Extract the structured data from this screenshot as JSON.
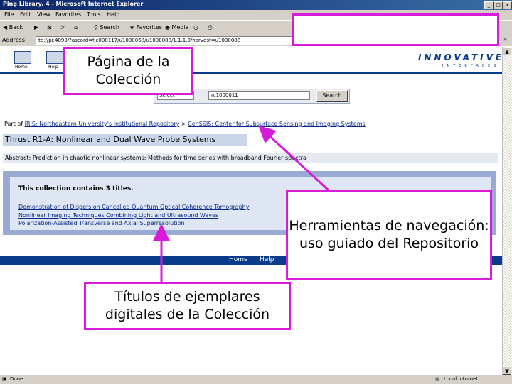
{
  "window": {
    "title": "Ping Library, 4 - Microsoft Internet Explorer",
    "controls": [
      "_",
      "□",
      "x"
    ]
  },
  "menubar": [
    "File",
    "Edit",
    "View",
    "Favorites",
    "Tools",
    "Help"
  ],
  "toolbar": {
    "back": "Back",
    "search": "Search",
    "favorites": "Favorites",
    "media": "Media"
  },
  "address": {
    "label": "Address",
    "url": "tp://pi:4893/?ascord=fJc000117/u1000068/u1000088/1.1.1.3/harvest=u1000088"
  },
  "site": {
    "nav": [
      {
        "label": "Home",
        "icon": "home-icon"
      },
      {
        "label": "Help",
        "icon": "help-icon"
      }
    ],
    "brand": "INNOVATIVE",
    "brand_sub": "INTERFACES",
    "search": {
      "scope": "Select",
      "query": "rc1000011",
      "button": "Search"
    },
    "breadcrumb": {
      "prefix": "Part of ",
      "root": "IRIS: Northeastern University's Institutional Repository",
      "sep": " > ",
      "community": "CenSSIS: Center for Subsurface Sensing and Imaging Systems"
    },
    "collection_title": "Thrust R1-A: Nonlinear and Dual Wave Probe Systems",
    "abstract": "Abstract: Prediction in chaotic nonlinear systems: Methods for time series with broadband Fourier spectra",
    "list_heading": "This collection contains 3 titles.",
    "items": [
      "Demonstration of Dispersion Cancelled Quantum Optical Coherence Tomography",
      "Nonlinear Imaging Techniques Combining Light and Ultrasound Waves",
      "Polarization-Assisted Transverse and Axial Superresolution"
    ],
    "footer": [
      "Home",
      "Help"
    ]
  },
  "status": {
    "left": "Done",
    "right": "Local intranet"
  },
  "callouts": {
    "collection": "Página de la Colección",
    "navigation": "Herramientas de navegación: uso guiado del Repositorio",
    "titles": "Títulos de ejemplares digitales de la Colección"
  }
}
